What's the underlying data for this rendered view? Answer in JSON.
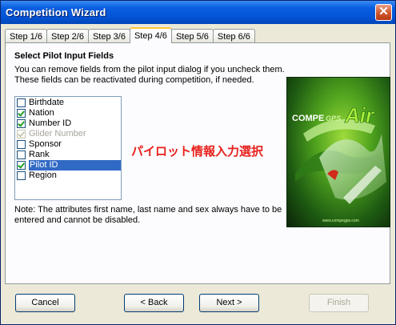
{
  "window": {
    "title": "Competition Wizard"
  },
  "tabs": [
    {
      "label": "Step 1/6"
    },
    {
      "label": "Step 2/6"
    },
    {
      "label": "Step 3/6"
    },
    {
      "label": "Step 4/6",
      "active": true
    },
    {
      "label": "Step 5/6"
    },
    {
      "label": "Step 6/6"
    }
  ],
  "content": {
    "heading": "Select Pilot Input Fields",
    "description_line1": "You can remove fields from the pilot input dialog if you uncheck them.",
    "description_line2": "These fields can be reactivated during competition, if needed.",
    "fields": [
      {
        "label": "Birthdate",
        "checked": false,
        "enabled": true
      },
      {
        "label": "Nation",
        "checked": true,
        "enabled": true
      },
      {
        "label": "Number ID",
        "checked": true,
        "enabled": true
      },
      {
        "label": "Glider Number",
        "checked": true,
        "enabled": false
      },
      {
        "label": "Sponsor",
        "checked": false,
        "enabled": true
      },
      {
        "label": "Rank",
        "checked": false,
        "enabled": true
      },
      {
        "label": "Pilot ID",
        "checked": true,
        "enabled": true,
        "selected": true
      },
      {
        "label": "Region",
        "checked": false,
        "enabled": true
      }
    ],
    "annotation": "パイロット情報入力選択",
    "note_line1": "Note: The attributes first name, last name and sex always have to be",
    "note_line2": "entered and cannot be disabled.",
    "logo": {
      "brand_left": "COMPE",
      "brand_mid": "GPS",
      "brand_right": "Air",
      "url": "www.compegps.com"
    }
  },
  "buttons": {
    "cancel": "Cancel",
    "back": "< Back",
    "next": "Next >",
    "finish": "Finish"
  },
  "colors": {
    "accent_red": "#E8201C",
    "selection": "#316AC5",
    "titlebar": "#0453D6"
  }
}
